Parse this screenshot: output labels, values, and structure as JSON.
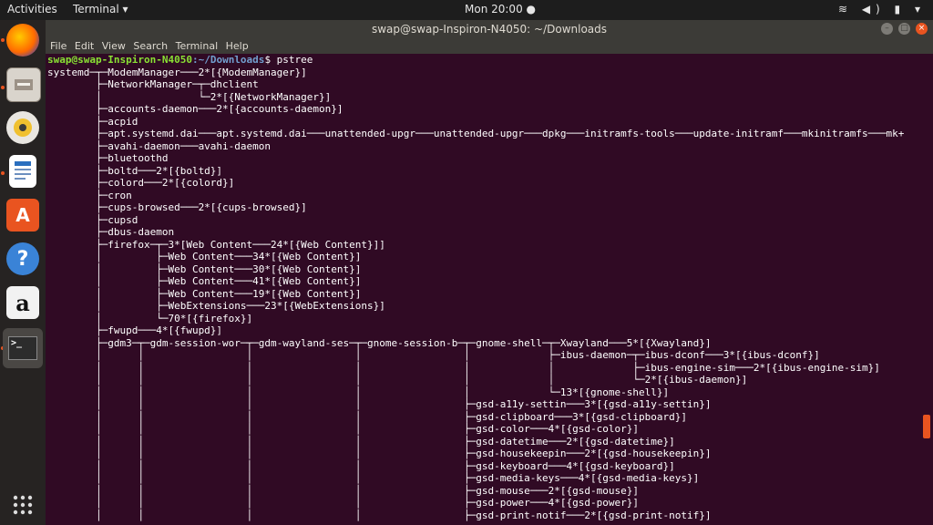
{
  "topbar": {
    "activities": "Activities",
    "app_menu": "Terminal ▾",
    "clock": "Mon 20:00 ●",
    "tray": "≋ ◀) ▮ ▾"
  },
  "dock": {
    "items": [
      {
        "name": "firefox-icon"
      },
      {
        "name": "files-icon"
      },
      {
        "name": "rhythmbox-icon"
      },
      {
        "name": "writer-icon"
      },
      {
        "name": "software-icon"
      },
      {
        "name": "help-icon"
      },
      {
        "name": "amazon-icon"
      },
      {
        "name": "terminal-icon"
      },
      {
        "name": "show-apps-icon"
      }
    ]
  },
  "window": {
    "title": "swap@swap-Inspiron-N4050: ~/Downloads",
    "menu": [
      "File",
      "Edit",
      "View",
      "Search",
      "Terminal",
      "Help"
    ]
  },
  "terminal": {
    "prompt_user": "swap@swap-Inspiron-N4050",
    "prompt_path": ":~/Downloads",
    "prompt_cmd": "$ pstree",
    "lines": [
      "systemd─┬─ModemManager───2*[{ModemManager}]",
      "        ├─NetworkManager─┬─dhclient",
      "        │                └─2*[{NetworkManager}]",
      "        ├─accounts-daemon───2*[{accounts-daemon}]",
      "        ├─acpid",
      "        ├─apt.systemd.dai───apt.systemd.dai───unattended-upgr───unattended-upgr───dpkg───initramfs-tools───update-initramf───mkinitramfs───mk+",
      "        ├─avahi-daemon───avahi-daemon",
      "        ├─bluetoothd",
      "        ├─boltd───2*[{boltd}]",
      "        ├─colord───2*[{colord}]",
      "        ├─cron",
      "        ├─cups-browsed───2*[{cups-browsed}]",
      "        ├─cupsd",
      "        ├─dbus-daemon",
      "        ├─firefox─┬─3*[Web Content───24*[{Web Content}]]",
      "        │         ├─Web Content───34*[{Web Content}]",
      "        │         ├─Web Content───30*[{Web Content}]",
      "        │         ├─Web Content───41*[{Web Content}]",
      "        │         ├─Web Content───19*[{Web Content}]",
      "        │         ├─WebExtensions───23*[{WebExtensions}]",
      "        │         └─70*[{firefox}]",
      "        ├─fwupd───4*[{fwupd}]",
      "        ├─gdm3─┬─gdm-session-wor─┬─gdm-wayland-ses─┬─gnome-session-b─┬─gnome-shell─┬─Xwayland───5*[{Xwayland}]",
      "        │      │                 │                 │                 │             ├─ibus-daemon─┬─ibus-dconf───3*[{ibus-dconf}]",
      "        │      │                 │                 │                 │             │             ├─ibus-engine-sim───2*[{ibus-engine-sim}]",
      "        │      │                 │                 │                 │             │             └─2*[{ibus-daemon}]",
      "        │      │                 │                 │                 │             └─13*[{gnome-shell}]",
      "        │      │                 │                 │                 ├─gsd-a11y-settin───3*[{gsd-a11y-settin}]",
      "        │      │                 │                 │                 ├─gsd-clipboard───3*[{gsd-clipboard}]",
      "        │      │                 │                 │                 ├─gsd-color───4*[{gsd-color}]",
      "        │      │                 │                 │                 ├─gsd-datetime───2*[{gsd-datetime}]",
      "        │      │                 │                 │                 ├─gsd-housekeepin───2*[{gsd-housekeepin}]",
      "        │      │                 │                 │                 ├─gsd-keyboard───4*[{gsd-keyboard}]",
      "        │      │                 │                 │                 ├─gsd-media-keys───4*[{gsd-media-keys}]",
      "        │      │                 │                 │                 ├─gsd-mouse───2*[{gsd-mouse}]",
      "        │      │                 │                 │                 ├─gsd-power───4*[{gsd-power}]",
      "        │      │                 │                 │                 ├─gsd-print-notif───2*[{gsd-print-notif}]"
    ]
  },
  "colors": {
    "terminal_bg": "#300a24",
    "accent": "#e95420",
    "prompt_user": "#8ae234",
    "prompt_path": "#729fcf"
  }
}
